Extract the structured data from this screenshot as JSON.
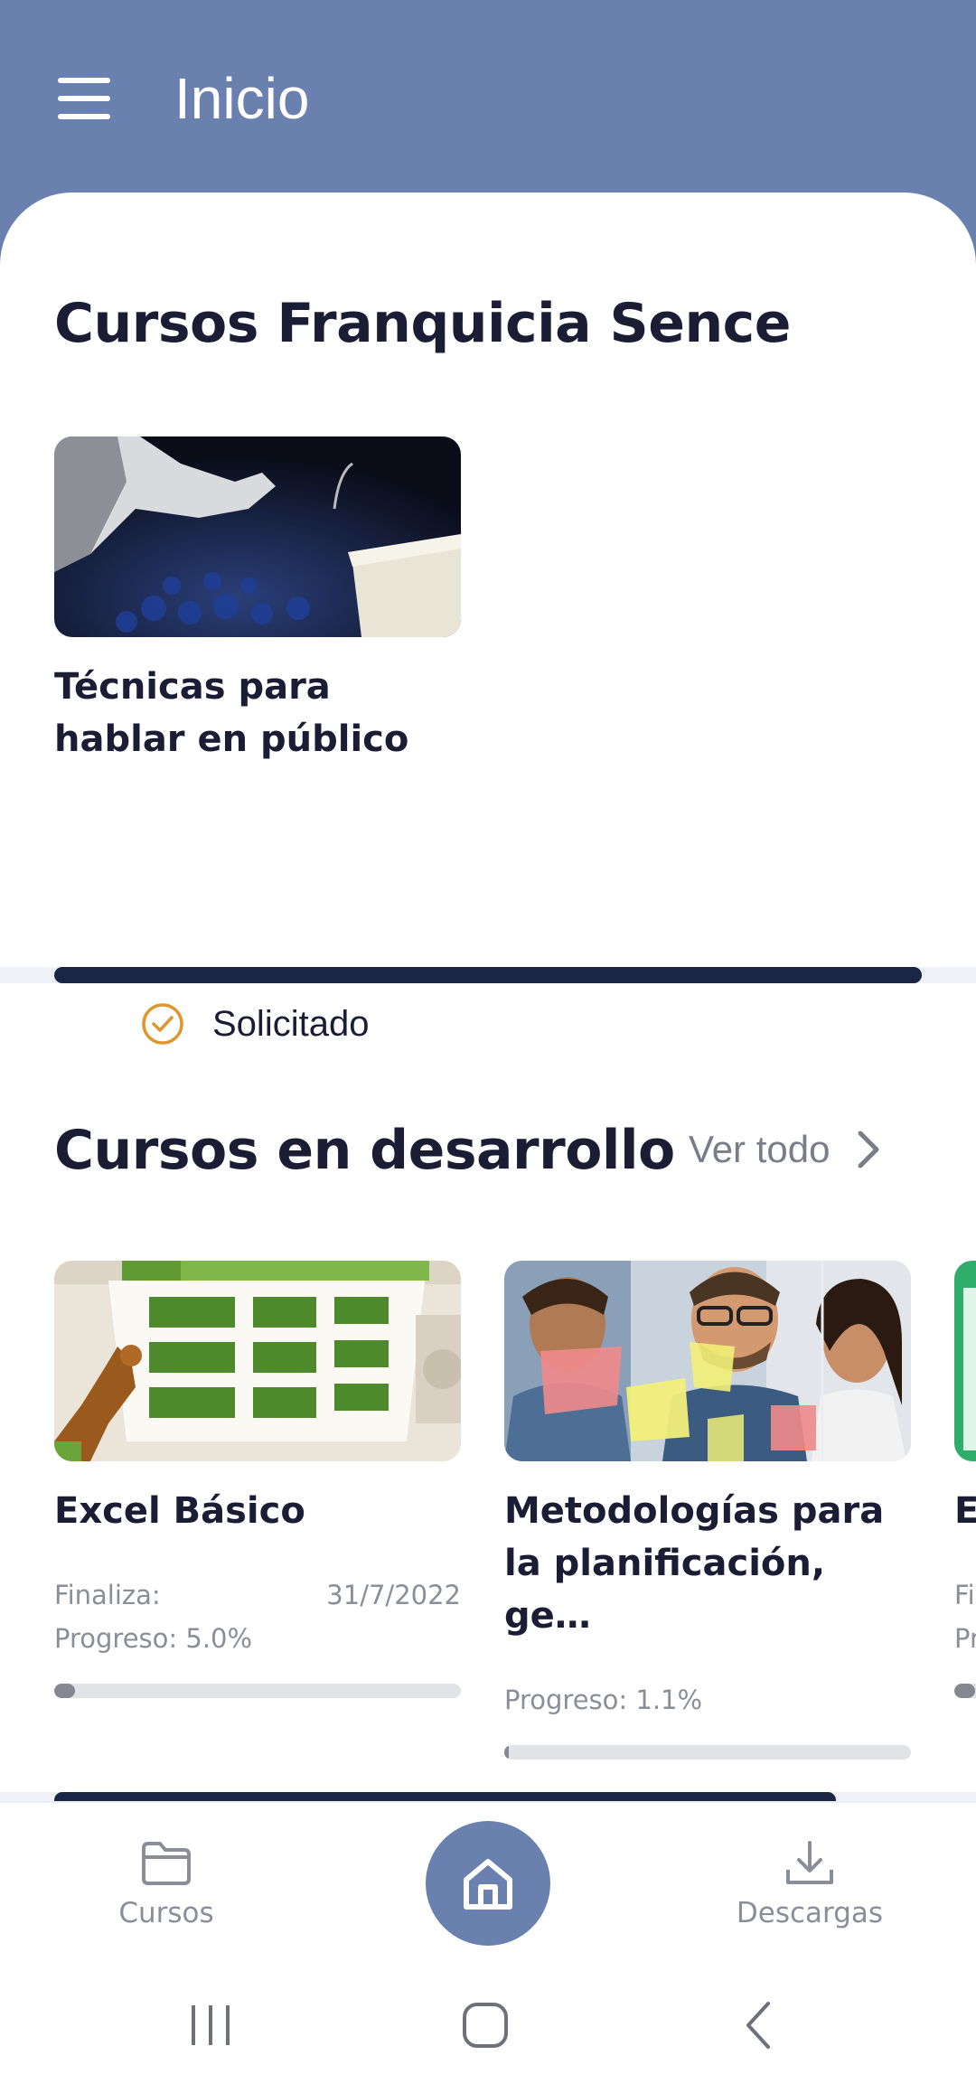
{
  "app_bar": {
    "title": "Inicio"
  },
  "section_sence": {
    "title": "Cursos Franquicia Sence",
    "course": {
      "title": "Técnicas para hablar en público",
      "status": "Solicitado"
    }
  },
  "section_dev": {
    "title": "Cursos en desarrollo",
    "see_all": "Ver todo",
    "courses": [
      {
        "title": "Excel Básico",
        "ends_label": "Finaliza:",
        "end_date": "31/7/2022",
        "progress_label": "Progreso: 5.0%",
        "progress": 0.05
      },
      {
        "title": "Metodologías para la planificación, ge…",
        "progress_label": "Progreso: 1.1%",
        "progress": 0.011
      },
      {
        "title": "Ex",
        "ends_label": "Fi",
        "progress_label": "Pr",
        "progress": 0.05
      }
    ]
  },
  "bottom_nav": {
    "courses": "Cursos",
    "downloads": "Descargas"
  },
  "colors": {
    "primary": "#6a81b0",
    "dark": "#1b2546",
    "check": "#e0962f"
  }
}
